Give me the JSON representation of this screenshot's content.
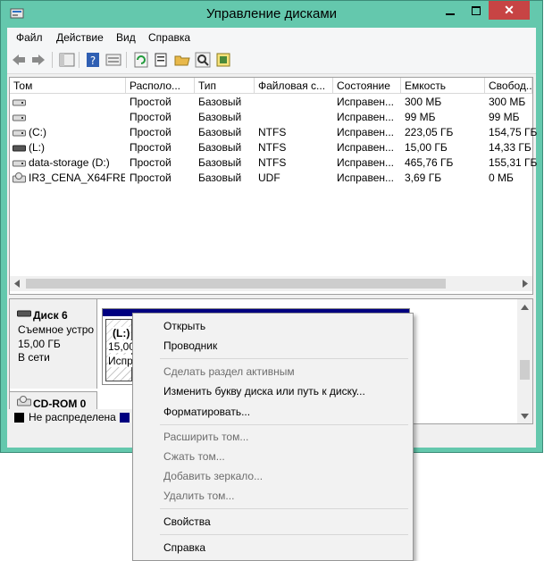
{
  "window": {
    "title": "Управление дисками",
    "close_glyph": "✕",
    "accent": "#64c8ad",
    "close_color": "#c74444"
  },
  "menu": [
    "Файл",
    "Действие",
    "Вид",
    "Справка"
  ],
  "toolbar_icons": [
    "back-arrow-icon",
    "forward-arrow-icon",
    "console-tree-icon",
    "help-icon",
    "properties-list-icon",
    "refresh-icon",
    "properties-icon",
    "open-folder-icon",
    "search-icon",
    "export-icon"
  ],
  "volumes": {
    "columns": [
      "Том",
      "Располо...",
      "Тип",
      "Файловая с...",
      "Состояние",
      "Емкость",
      "Свобод..."
    ],
    "rows": [
      {
        "name": "",
        "layout": "Простой",
        "type": "Базовый",
        "fs": "",
        "status": "Исправен...",
        "capacity": "300 МБ",
        "free": "300 МБ",
        "icon": "disk-volume-icon"
      },
      {
        "name": "",
        "layout": "Простой",
        "type": "Базовый",
        "fs": "",
        "status": "Исправен...",
        "capacity": "99 МБ",
        "free": "99 МБ",
        "icon": "disk-volume-icon"
      },
      {
        "name": "(C:)",
        "layout": "Простой",
        "type": "Базовый",
        "fs": "NTFS",
        "status": "Исправен...",
        "capacity": "223,05 ГБ",
        "free": "154,75 ГБ",
        "icon": "disk-volume-icon"
      },
      {
        "name": "(L:)",
        "layout": "Простой",
        "type": "Базовый",
        "fs": "NTFS",
        "status": "Исправен...",
        "capacity": "15,00 ГБ",
        "free": "14,33 ГБ",
        "icon": "removable-volume-icon"
      },
      {
        "name": "data-storage (D:)",
        "layout": "Простой",
        "type": "Базовый",
        "fs": "NTFS",
        "status": "Исправен...",
        "capacity": "465,76 ГБ",
        "free": "155,31 ГБ",
        "icon": "disk-volume-icon"
      },
      {
        "name": "IR3_CENA_X64FRE...",
        "layout": "Простой",
        "type": "Базовый",
        "fs": "UDF",
        "status": "Исправен...",
        "capacity": "3,69 ГБ",
        "free": "0 МБ",
        "icon": "cd-volume-icon"
      }
    ]
  },
  "disks": {
    "disk6": {
      "name": "Диск 6",
      "kind": "Съемное устро",
      "size": "15,00 ГБ",
      "state": "В сети",
      "partition_letter": "(L:)",
      "partition_size": "15,00",
      "partition_status": "Испр"
    },
    "cdrom": {
      "name": "CD-ROM 0"
    }
  },
  "legend": [
    {
      "label": "Не распределена",
      "color": "#000000"
    },
    {
      "label": "",
      "color": "#000080"
    }
  ],
  "context_menu": [
    {
      "label": "Открыть",
      "enabled": true
    },
    {
      "label": "Проводник",
      "enabled": true
    },
    {
      "separator": true
    },
    {
      "label": "Сделать раздел активным",
      "enabled": false
    },
    {
      "label": "Изменить букву диска или путь к диску...",
      "enabled": true
    },
    {
      "label": "Форматировать...",
      "enabled": true
    },
    {
      "separator": true
    },
    {
      "label": "Расширить том...",
      "enabled": false
    },
    {
      "label": "Сжать том...",
      "enabled": false
    },
    {
      "label": "Добавить зеркало...",
      "enabled": false
    },
    {
      "label": "Удалить том...",
      "enabled": false
    },
    {
      "separator": true
    },
    {
      "label": "Свойства",
      "enabled": true
    },
    {
      "separator": true
    },
    {
      "label": "Справка",
      "enabled": true
    }
  ]
}
